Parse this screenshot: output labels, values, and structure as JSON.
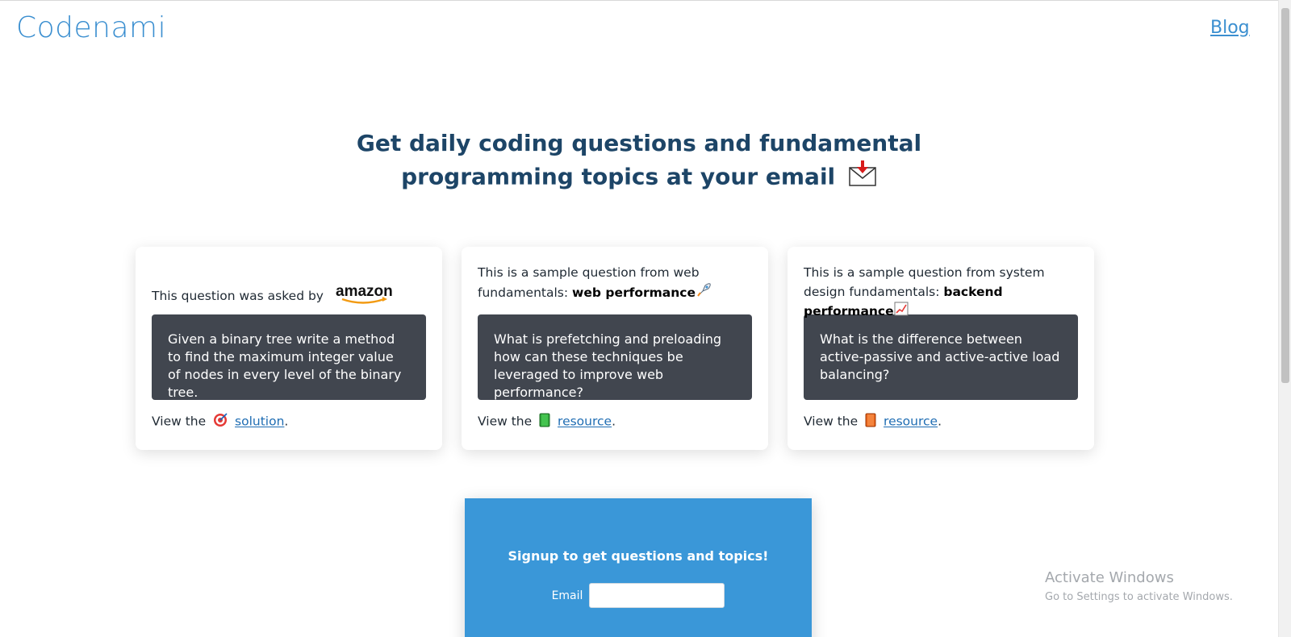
{
  "header": {
    "brand": "Codenami",
    "blog_link": "Blog"
  },
  "hero": {
    "title_line1": "Get daily coding questions and fundamental",
    "title_line2": "programming topics at your email"
  },
  "cards": [
    {
      "intro": "This question was asked by",
      "company_logo": "amazon",
      "question": "Given a binary tree write a method to find the maximum integer value of nodes in every level of the binary tree.",
      "view_prefix": "View the",
      "link_text": "solution",
      "icon": "target-icon"
    },
    {
      "intro_prefix": "This is a sample question from web fundamentals:",
      "topic": "web performance",
      "topic_icon": "rocket-icon",
      "question": "What is prefetching and preloading how can these techniques be leveraged to improve web performance?",
      "view_prefix": "View the",
      "link_text": "resource",
      "icon": "green-book-icon"
    },
    {
      "intro_prefix": "This is a sample question from system design fundamentals:",
      "topic": "backend performance",
      "topic_icon": "chart-increasing-icon",
      "question": "What is the difference between active-passive and active-active load balancing?",
      "view_prefix": "View the",
      "link_text": "resource",
      "icon": "orange-book-icon"
    }
  ],
  "signup": {
    "title": "Signup to get questions and topics!",
    "email_label": "Email",
    "email_value": ""
  },
  "watermark": {
    "title": "Activate Windows",
    "subtitle": "Go to Settings to activate Windows."
  },
  "colors": {
    "brand": "#3b8fd0",
    "hero_text": "#1d4567",
    "question_box": "#41464f",
    "signup_bg": "#3a97d8"
  }
}
